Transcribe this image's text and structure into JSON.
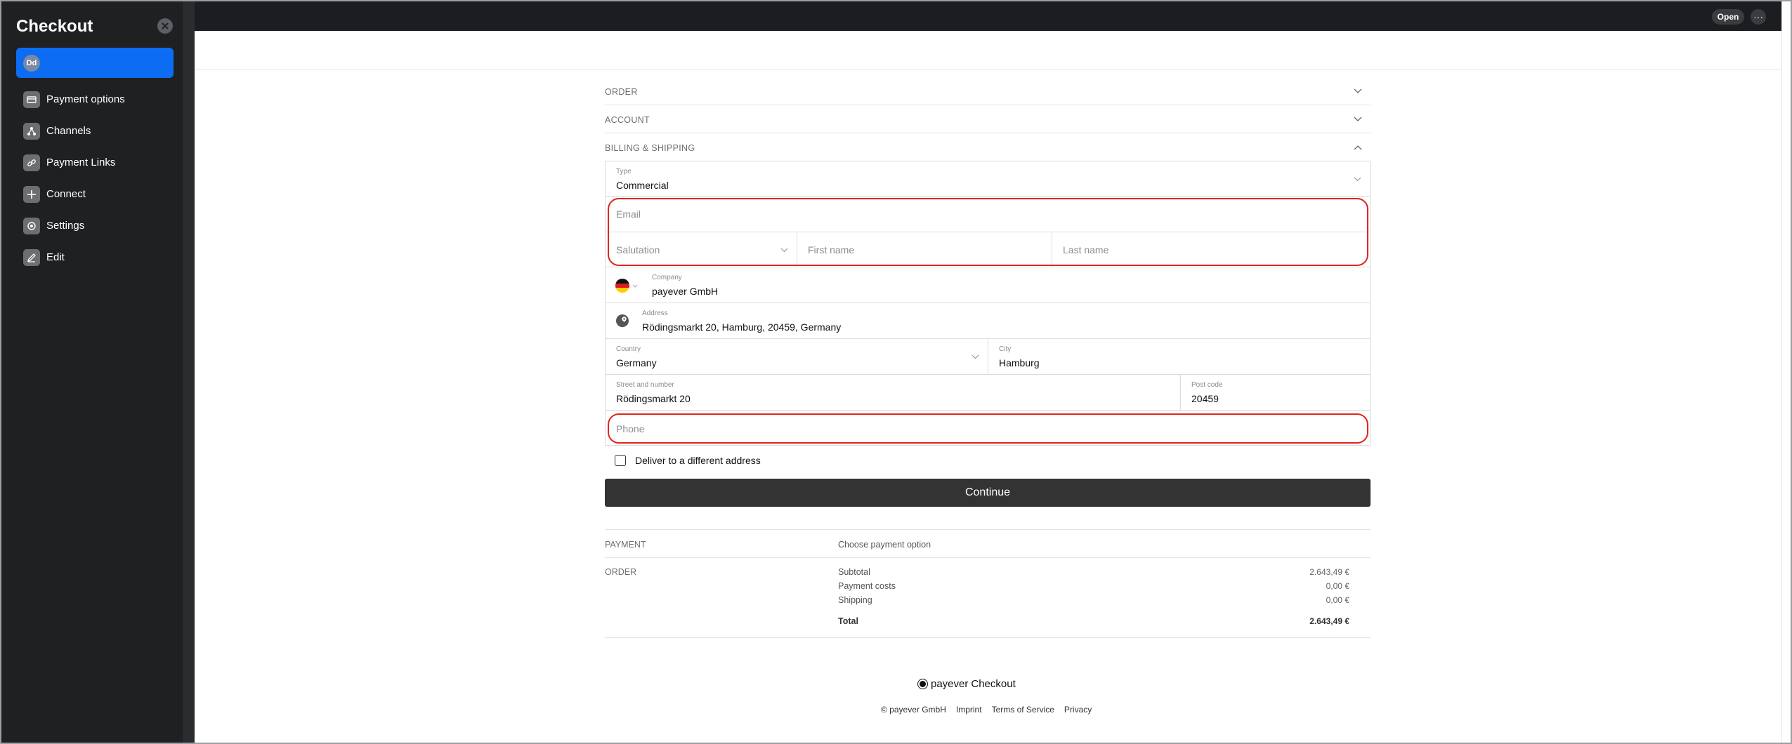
{
  "sidebar": {
    "title": "Checkout",
    "avatar_initials": "Dd",
    "items": [
      {
        "label": "Payment options",
        "icon": "card-icon"
      },
      {
        "label": "Channels",
        "icon": "channels-icon"
      },
      {
        "label": "Payment Links",
        "icon": "link-icon"
      },
      {
        "label": "Connect",
        "icon": "plus-icon"
      },
      {
        "label": "Settings",
        "icon": "gear-icon"
      },
      {
        "label": "Edit",
        "icon": "pencil-icon"
      }
    ]
  },
  "topbar": {
    "open_label": "Open",
    "more_label": "···"
  },
  "checkout": {
    "sections": {
      "order": "ORDER",
      "account": "ACCOUNT",
      "billing": "BILLING & SHIPPING"
    },
    "form": {
      "type_label": "Type",
      "type_value": "Commercial",
      "email_placeholder": "Email",
      "salutation_placeholder": "Salutation",
      "first_name_placeholder": "First name",
      "last_name_placeholder": "Last name",
      "company_label": "Company",
      "company_value": "payever GmbH",
      "address_label": "Address",
      "address_value": "Rödingsmarkt 20, Hamburg, 20459, Germany",
      "country_label": "Country",
      "country_value": "Germany",
      "city_label": "City",
      "city_value": "Hamburg",
      "street_label": "Street and number",
      "street_value": "Rödingsmarkt 20",
      "postcode_label": "Post code",
      "postcode_value": "20459",
      "phone_placeholder": "Phone",
      "deliver_different_label": "Deliver to a different address",
      "continue_label": "Continue"
    },
    "summary": {
      "payment_label": "PAYMENT",
      "payment_value": "Choose payment option",
      "order_label": "ORDER",
      "rows": [
        {
          "label": "Subtotal",
          "value": "2.643,49 €"
        },
        {
          "label": "Payment costs",
          "value": "0,00 €"
        },
        {
          "label": "Shipping",
          "value": "0,00 €"
        }
      ],
      "total_label": "Total",
      "total_value": "2.643,49 €"
    },
    "footer": {
      "brand": "payever",
      "product": "Checkout",
      "copyright": "© payever GmbH",
      "links": [
        "Imprint",
        "Terms of Service",
        "Privacy"
      ]
    }
  },
  "colors": {
    "accent": "#0c6cf2",
    "highlight": "#e0251f",
    "button": "#333333"
  }
}
